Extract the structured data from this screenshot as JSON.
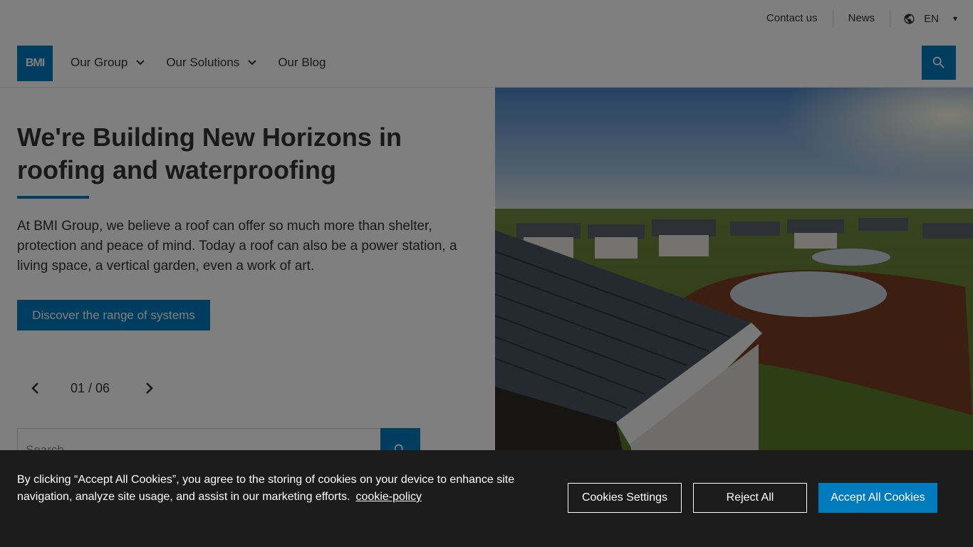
{
  "utility_bar": {
    "contact_label": "Contact us",
    "news_label": "News",
    "language_label": "EN",
    "language_caret": "▾"
  },
  "nav": {
    "logo_text": "BMI",
    "items": [
      {
        "label": "Our Group"
      },
      {
        "label": "Our Solutions"
      },
      {
        "label": "Our Blog"
      }
    ],
    "search_icon": "search-icon"
  },
  "hero": {
    "title": "We're Building New Horizons in roofing and waterproofing",
    "body": "At BMI Group, we believe a roof can offer so much more than shelter, protection and peace of mind. Today a roof can also be a power station, a living space, a vertical garden, even a work of art.",
    "cta_label": "Discover the range of systems",
    "pager_text": "01 / 06",
    "search_placeholder": "Search..."
  },
  "cookie_banner": {
    "text": "By clicking “Accept All Cookies”, you agree to the storing of cookies on your device to enhance site navigation, analyze site usage, and assist in our marketing efforts.",
    "policy_link": "cookie-policy",
    "settings_label": "Cookies Settings",
    "reject_label": "Reject All",
    "accept_label": "Accept All Cookies"
  },
  "colors": {
    "brand_blue": "#007bbd",
    "banner_bg": "#1c1c1c"
  }
}
